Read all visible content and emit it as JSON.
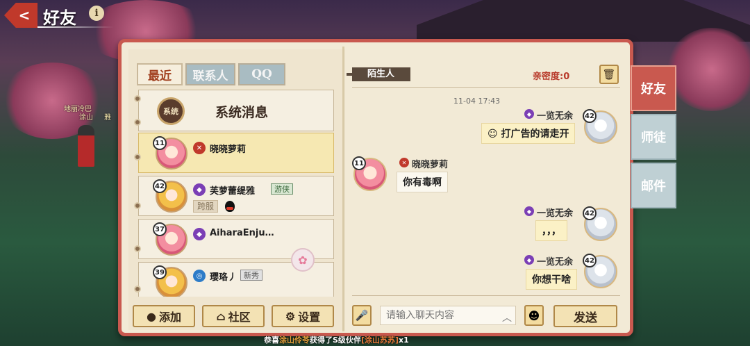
{
  "header": {
    "title": "好友",
    "back_label": "<"
  },
  "scene": {
    "npc_labels": [
      "地丽冷巴",
      "涂山",
      "雅"
    ]
  },
  "tabs": [
    {
      "label": "最近",
      "active": true
    },
    {
      "label": "联系人",
      "active": false
    },
    {
      "label": "QQ",
      "active": false
    }
  ],
  "system": {
    "badge": "系统",
    "title": "系统消息"
  },
  "friends": [
    {
      "level": "11",
      "name": "晓晓萝莉",
      "school": "red"
    },
    {
      "level": "42",
      "name": "芙萝蕾缇雅",
      "tag": "游侠",
      "cross": "跨服",
      "qq": true,
      "school": "purple"
    },
    {
      "level": "37",
      "name": "AiharaEnju…",
      "school": "purple"
    },
    {
      "level": "39",
      "name": "璎珞丿",
      "tag": "新秀",
      "school": "blue"
    }
  ],
  "bottom_buttons": {
    "add": "添加",
    "community": "社区",
    "settings": "设置"
  },
  "chat": {
    "stranger_label": "陌生人",
    "intimacy_label": "亲密度:",
    "intimacy_value": "0",
    "timestamp": "11-04 17:43",
    "messages": [
      {
        "side": "right",
        "name": "一览无余",
        "level": "42",
        "text": "打广告的请走开"
      },
      {
        "side": "left",
        "name": "晓晓萝莉",
        "level": "11",
        "text": "你有毒啊"
      },
      {
        "side": "right",
        "name": "一览无余",
        "level": "42",
        "text": "，，，"
      },
      {
        "side": "right",
        "name": "一览无余",
        "level": "42",
        "text": "你想干啥"
      }
    ],
    "input_placeholder": "请输入聊天内容",
    "send_label": "发送"
  },
  "side_tabs": [
    {
      "label": "好友",
      "active": true
    },
    {
      "label": "师徒",
      "active": false
    },
    {
      "label": "邮件",
      "active": false
    }
  ],
  "broadcast": {
    "prefix": "恭喜",
    "player": "涂山伶苓",
    "middle": "获得了S级伙伴",
    "item": "[涂山苏苏]",
    "suffix": "x1"
  },
  "colors": {
    "accent": "#c9594f",
    "panel": "#f2ead6",
    "bubble": "#fbf1c6"
  }
}
